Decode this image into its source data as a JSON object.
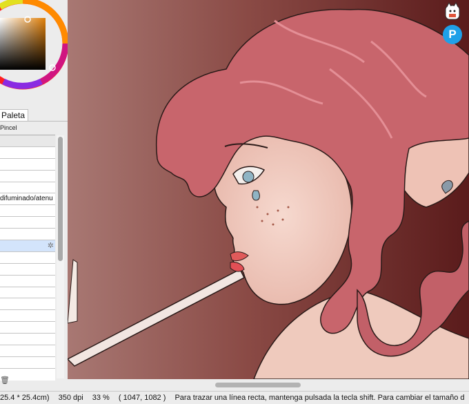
{
  "left_panel": {
    "palette_tab": "Paleta",
    "brush_header": "Pincel",
    "brush_rows": [
      "",
      "",
      "",
      "",
      "",
      "difuminado/atenu",
      "",
      "",
      "",
      "",
      "",
      "",
      "",
      "",
      "",
      "",
      "",
      "",
      "",
      ""
    ],
    "selected_row": 9
  },
  "status": {
    "size": "25.4 * 25.4cm)",
    "dpi": "350 dpi",
    "zoom": "33 %",
    "coords": "( 1047, 1082 )",
    "hint": "Para trazar una línea recta, mantenga pulsada la tecla shift. Para cambiar el tamaño d"
  },
  "colors": {
    "accent": "#1fa0e8",
    "selection": "#d3e4fb",
    "hair": "#c8656c",
    "background": "#7a2e2c"
  },
  "icons": {
    "p_button": "P",
    "gear": "✲",
    "trash": "🗑"
  }
}
